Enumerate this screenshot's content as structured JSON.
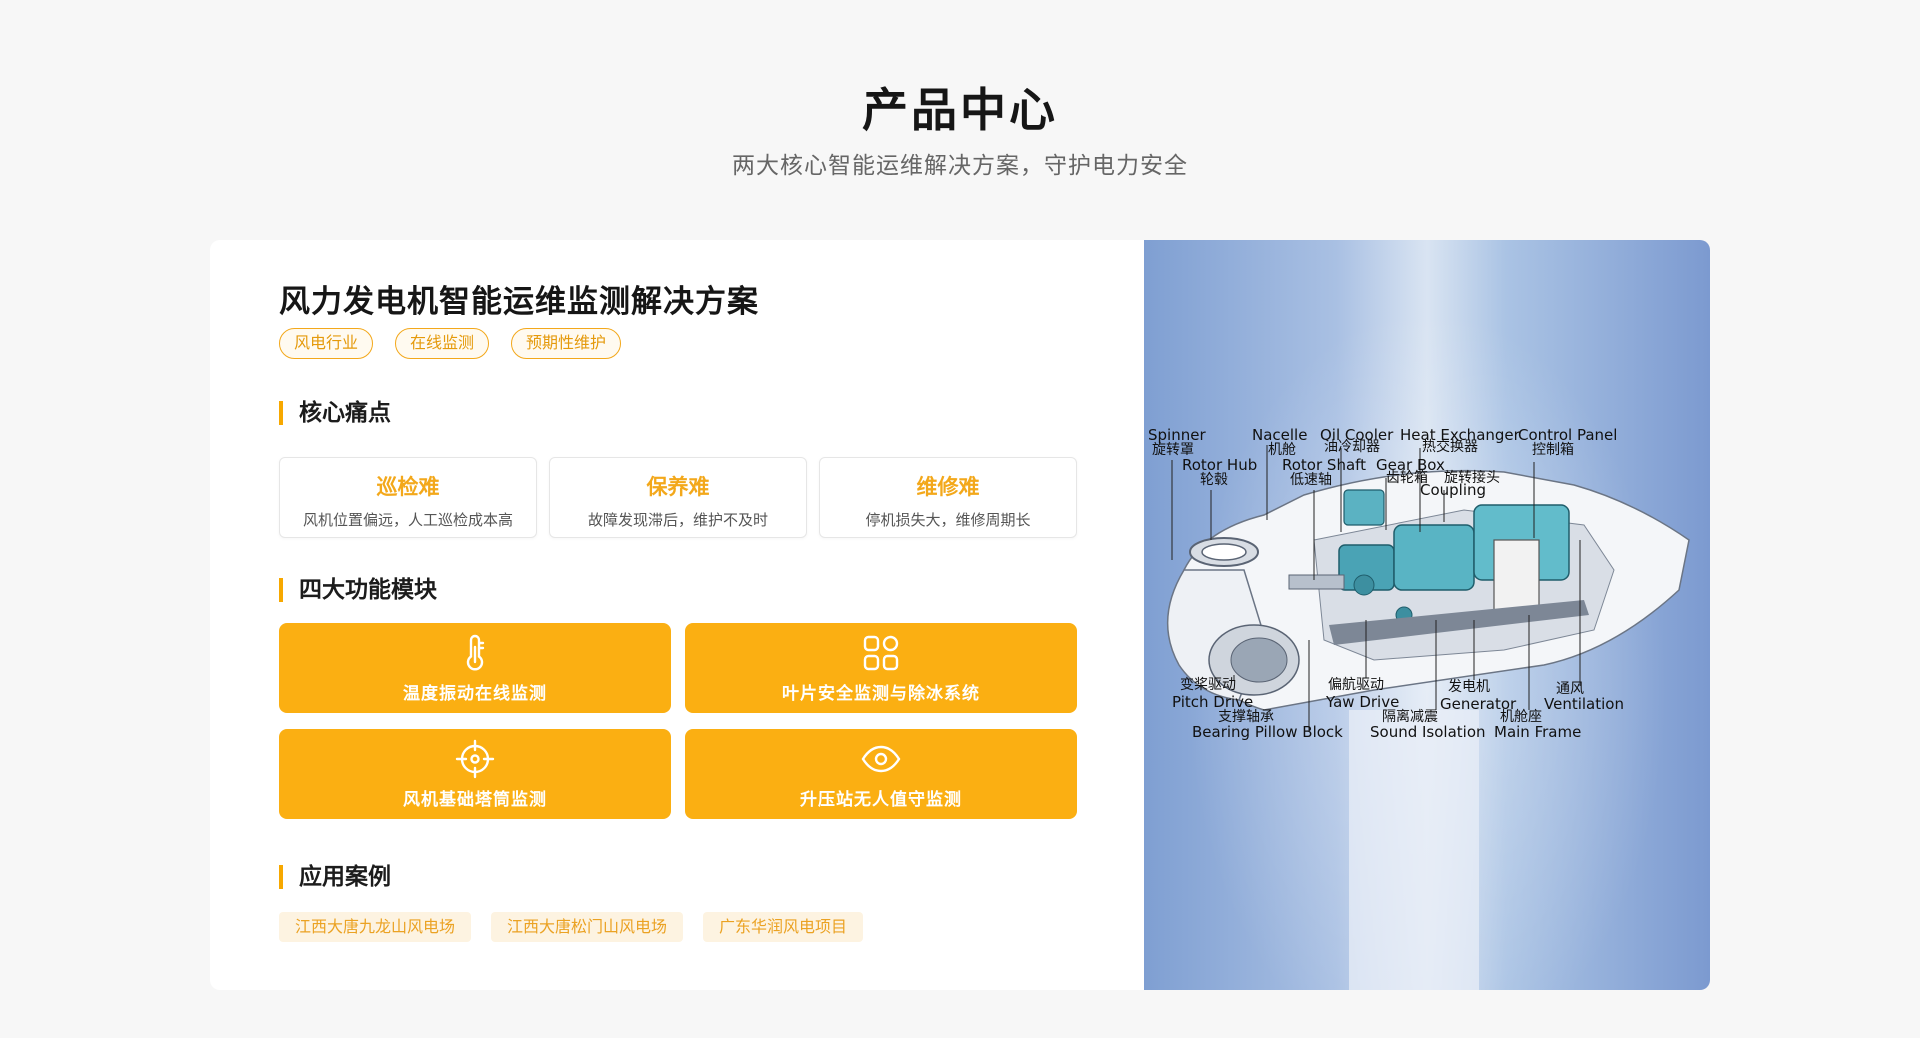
{
  "header": {
    "title": "产品中心",
    "subtitle": "两大核心智能运维解决方案，守护电力安全"
  },
  "solution": {
    "title": "风力发电机智能运维监测解决方案",
    "tags": [
      "风电行业",
      "在线监测",
      "预期性维护"
    ],
    "pain_heading": "核心痛点",
    "pains": [
      {
        "title": "巡检难",
        "desc": "风机位置偏远，人工巡检成本高"
      },
      {
        "title": "保养难",
        "desc": "故障发现滞后，维护不及时"
      },
      {
        "title": "维修难",
        "desc": "停机损失大，维修周期长"
      }
    ],
    "modules_heading": "四大功能模块",
    "modules": [
      {
        "label": "温度振动在线监测",
        "icon": "thermometer-icon"
      },
      {
        "label": "叶片安全监测与除冰系统",
        "icon": "grid-icon"
      },
      {
        "label": "风机基础塔筒监测",
        "icon": "crosshair-icon"
      },
      {
        "label": "升压站无人值守监测",
        "icon": "eye-icon"
      }
    ],
    "cases_heading": "应用案例",
    "cases": [
      "江西大唐九龙山风电场",
      "江西大唐松门山风电场",
      "广东华润风电项目"
    ]
  },
  "diagram": {
    "labels": {
      "spinner_en": "Spinner",
      "spinner_zh": "旋转罩",
      "nacelle_en": "Nacelle",
      "nacelle_zh": "机舱",
      "oil_cooler_en": "Oil Cooler",
      "oil_cooler_zh": "油冷却器",
      "heat_exchanger_en": "Heat Exchanger",
      "heat_exchanger_zh": "热交换器",
      "control_panel_en": "Control Panel",
      "control_panel_zh": "控制箱",
      "rotor_hub_en": "Rotor Hub",
      "rotor_hub_zh": "轮毂",
      "rotor_shaft_en": "Rotor Shaft",
      "rotor_shaft_zh": "低速轴",
      "gear_box_en": "Gear Box",
      "gear_box_zh": "齿轮箱",
      "coupling_zh": "旋转接头",
      "coupling_en": "Coupling",
      "pitch_drive_zh": "变桨驱动",
      "pitch_drive_en": "Pitch Drive",
      "yaw_drive_zh": "偏航驱动",
      "yaw_drive_en": "Yaw Drive",
      "generator_zh": "发电机",
      "generator_en": "Generator",
      "ventilation_zh": "通风",
      "ventilation_en": "Ventilation",
      "bearing_zh": "支撑轴承",
      "bearing_en": "Bearing Pillow Block",
      "sound_zh": "隔离减震",
      "sound_en": "Sound Isolation",
      "frame_zh": "机舱座",
      "frame_en": "Main Frame"
    }
  }
}
